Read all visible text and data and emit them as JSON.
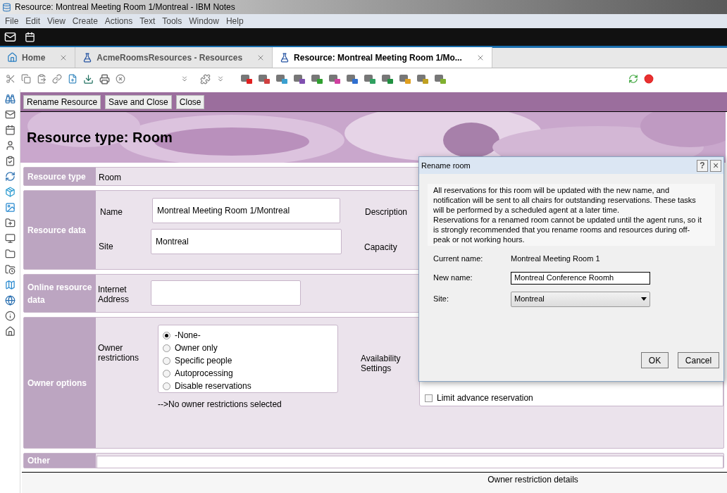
{
  "window": {
    "title": "Resource: Montreal Meeting Room 1/Montreal - IBM Notes"
  },
  "menu": [
    "File",
    "Edit",
    "View",
    "Create",
    "Actions",
    "Text",
    "Tools",
    "Window",
    "Help"
  ],
  "tabs": [
    {
      "label": "Home",
      "kind": "home",
      "selected": false
    },
    {
      "label": "AcmeRoomsResources - Resources",
      "kind": "db",
      "selected": false
    },
    {
      "label": "Resource: Montreal Meeting Room 1/Mo...",
      "kind": "db",
      "selected": true
    }
  ],
  "actions": [
    "Rename Resource",
    "Save and Close",
    "Close"
  ],
  "heading": "Resource type: Room",
  "resource_type": {
    "label": "Resource type",
    "value": "Room"
  },
  "resource_data": {
    "label": "Resource data",
    "name_label": "Name",
    "name_value": "Montreal Meeting Room 1/Montreal",
    "site_label": "Site",
    "site_value": "Montreal",
    "description_label": "Description",
    "capacity_label": "Capacity"
  },
  "online": {
    "label": "Online resource data",
    "field_label": "Internet Address"
  },
  "owner_options": {
    "label": "Owner options",
    "field_label": "Owner restrictions",
    "options": [
      {
        "label": "-None-",
        "selected": true
      },
      {
        "label": "Owner only",
        "selected": false
      },
      {
        "label": "Specific people",
        "selected": false
      },
      {
        "label": "Autoprocessing",
        "selected": false
      },
      {
        "label": "Disable reservations",
        "selected": false
      }
    ],
    "note": "-->No owner restrictions selected",
    "availability_label": "Availability Settings",
    "limit": {
      "label": "Limit advance reservation",
      "checked": false
    }
  },
  "other": {
    "label": "Other"
  },
  "footer": "Owner restriction details",
  "dialog": {
    "title": "Rename room",
    "help": "?",
    "close": "×",
    "message": [
      "All reservations for this room will be updated with the new name, and notification will be sent to all chairs for outstanding reservations. These tasks will be performed by a scheduled agent at a later time.",
      "Reservations for a renamed room cannot be updated until the agent runs, so it is strongly recommended that you rename rooms and resources during off-peak or not working hours."
    ],
    "current_label": "Current name:",
    "current_value": "Montreal Meeting Room 1",
    "new_label": "New name:",
    "new_value": "Montreal Conference Roomh",
    "site_label": "Site:",
    "site_value": "Montreal",
    "buttons": [
      "OK",
      "Cancel"
    ]
  }
}
